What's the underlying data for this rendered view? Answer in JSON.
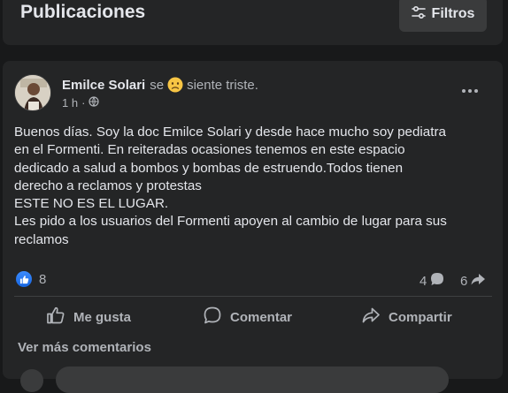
{
  "header": {
    "title": "Publicaciones",
    "filter_label": "Filtros"
  },
  "post": {
    "author": "Emilce Solari",
    "feeling_prefix": "se",
    "feeling_emoji": "sad-face-icon",
    "feeling_text": "siente triste.",
    "time": "1 h",
    "separator": "·",
    "privacy_icon": "globe-icon",
    "body_lines": [
      "Buenos días. Soy la doc Emilce Solari y desde hace mucho soy pediatra",
      "en el Formenti. En reiteradas ocasiones tenemos en este espacio",
      "dedicado a salud a bombos y bombas de estruendo.Todos tienen",
      "derecho a reclamos y protestas",
      "ESTE NO ES EL LUGAR.",
      "Les pido a los usuarios del Formenti apoyen al cambio de lugar para sus",
      "reclamos"
    ],
    "reaction_count": "8",
    "comment_count": "4",
    "share_count": "6"
  },
  "actions": {
    "like": "Me gusta",
    "comment": "Comentar",
    "share": "Compartir"
  },
  "comments": {
    "more_label": "Ver más comentarios"
  },
  "colors": {
    "background": "#18191a",
    "card": "#242526",
    "button": "#3a3b3c",
    "primary_text": "#e4e6eb",
    "secondary_text": "#b0b3b8",
    "like_blue": "#1877f2",
    "emoji_yellow": "#f7c544"
  }
}
